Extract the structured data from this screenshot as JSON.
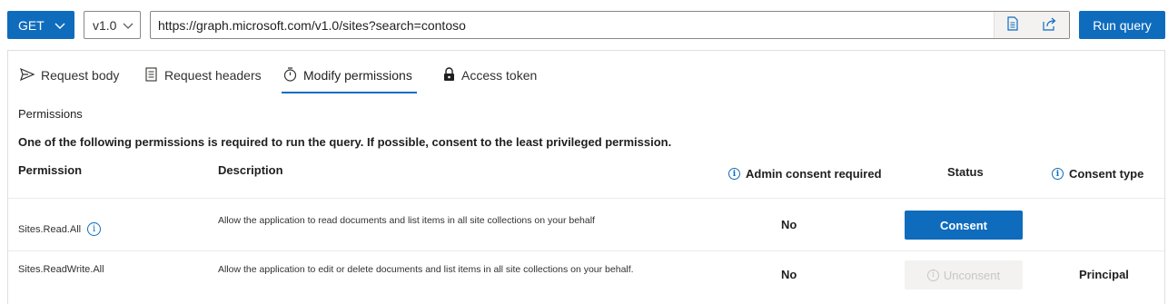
{
  "toolbar": {
    "method": "GET",
    "version": "v1.0",
    "url": "https://graph.microsoft.com/v1.0/sites?search=contoso",
    "run_label": "Run query"
  },
  "tabs": [
    {
      "label": "Request body",
      "icon": "send-icon"
    },
    {
      "label": "Request headers",
      "icon": "headers-icon"
    },
    {
      "label": "Modify permissions",
      "icon": "permissions-icon",
      "active": true
    },
    {
      "label": "Access token",
      "icon": "lock-icon"
    }
  ],
  "permissions": {
    "title": "Permissions",
    "notice": "One of the following permissions is required to run the query. If possible, consent to the least privileged permission.",
    "columns": {
      "permission": "Permission",
      "description": "Description",
      "admin": "Admin consent required",
      "status": "Status",
      "consent_type": "Consent type"
    },
    "rows": [
      {
        "name": "Sites.Read.All",
        "description": "Allow the application to read documents and list items in all site collections on your behalf",
        "admin": "No",
        "action": "Consent",
        "consent_type": ""
      },
      {
        "name": "Sites.ReadWrite.All",
        "description": "Allow the application to edit or delete documents and list items in all site collections on your behalf.",
        "admin": "No",
        "action": "Unconsent",
        "consent_type": "Principal"
      }
    ]
  },
  "colors": {
    "accent": "#0f6cbd",
    "disabled_bg": "#f3f2f1",
    "disabled_text": "#c8c6c4"
  }
}
